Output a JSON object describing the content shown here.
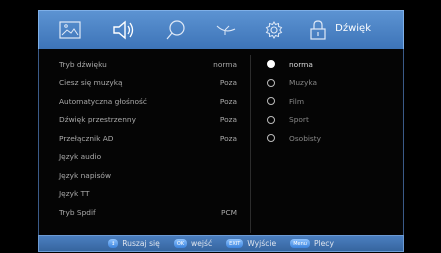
{
  "menu": {
    "title": "Dźwięk",
    "icons": [
      "picture-icon",
      "speaker-icon",
      "search-icon",
      "satellite-dish-icon",
      "gear-icon",
      "lock-icon"
    ]
  },
  "settings": [
    {
      "label": "Tryb dźwięku",
      "value": "norma"
    },
    {
      "label": "Ciesz się muzyką",
      "value": "Poza"
    },
    {
      "label": "Automatyczna głośność",
      "value": "Poza"
    },
    {
      "label": "Dźwięk przestrzenny",
      "value": "Poza"
    },
    {
      "label": "Przełącznik AD",
      "value": "Poza"
    },
    {
      "label": "Język audio",
      "value": ""
    },
    {
      "label": "Język napisów",
      "value": ""
    },
    {
      "label": "Język TT",
      "value": ""
    },
    {
      "label": "Tryb Spdif",
      "value": "PCM"
    }
  ],
  "modes": [
    {
      "label": "norma",
      "selected": true
    },
    {
      "label": "Muzyka",
      "selected": false
    },
    {
      "label": "Film",
      "selected": false
    },
    {
      "label": "Sport",
      "selected": false
    },
    {
      "label": "Osobisty",
      "selected": false
    }
  ],
  "help": {
    "move": {
      "key": "↕",
      "label": "Ruszaj się"
    },
    "ok": {
      "key": "OK",
      "label": "wejść"
    },
    "exit": {
      "key": "EXIT",
      "label": "Wyjście"
    },
    "menu": {
      "key": "Menu",
      "label": "Plecy"
    }
  },
  "colors": {
    "menu_bar": "#4a84c8",
    "help_bar": "#3f6fae",
    "panel": "#050505"
  }
}
